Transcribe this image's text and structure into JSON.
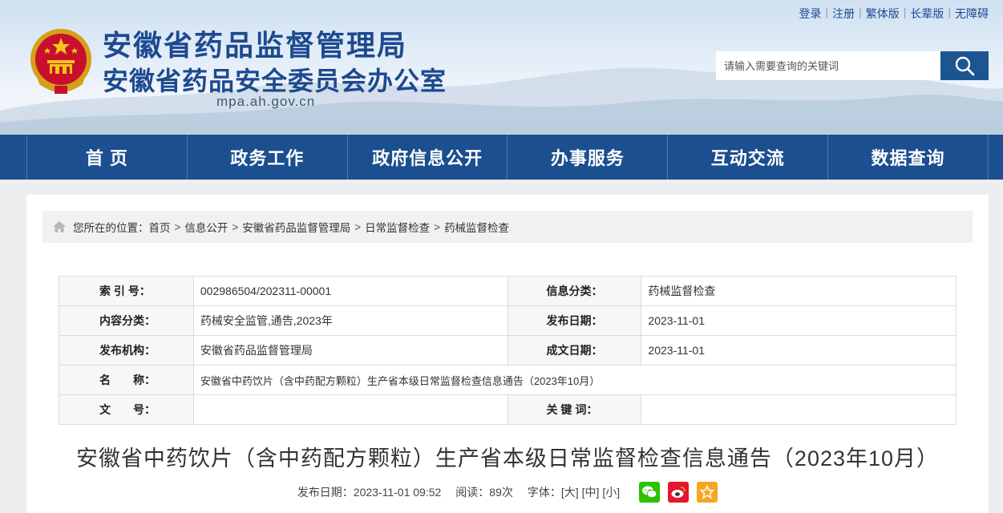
{
  "site": {
    "title_line1": "安徽省药品监督管理局",
    "title_line2": "安徽省药品安全委员会办公室",
    "domain": "mpa.ah.gov.cn"
  },
  "toplinks": [
    "登录",
    "注册",
    "繁体版",
    "长辈版",
    "无障碍"
  ],
  "search": {
    "placeholder": "请输入需要查询的关键词",
    "icon": "search-icon"
  },
  "nav": [
    "首 页",
    "政务工作",
    "政府信息公开",
    "办事服务",
    "互动交流",
    "数据查询"
  ],
  "breadcrumb": {
    "prefix": "您所在的位置：",
    "items": [
      "首页",
      "信息公开",
      "安徽省药品监督管理局",
      "日常监督检查",
      "药械监督检查"
    ],
    "separator": ">"
  },
  "meta_table": {
    "index_label": "索 引 号：",
    "index_value": "002986504/202311-00001",
    "category_label": "信息分类：",
    "category_value": "药械监督检查",
    "content_cat_label": "内容分类：",
    "content_cat_value": "药械安全监管,通告,2023年",
    "publish_date_label": "发布日期：",
    "publish_date_value": "2023-11-01",
    "org_label": "发布机构：",
    "org_value": "安徽省药品监督管理局",
    "created_date_label": "成文日期：",
    "created_date_value": "2023-11-01",
    "name_label": "名　　称：",
    "name_value": "安徽省中药饮片（含中药配方颗粒）生产省本级日常监督检查信息通告（2023年10月）",
    "docno_label": "文　　号：",
    "docno_value": "",
    "keywords_label": "关 键 词：",
    "keywords_value": ""
  },
  "article": {
    "title": "安徽省中药饮片（含中药配方颗粒）生产省本级日常监督检查信息通告（2023年10月）",
    "date_text": "发布日期：2023-11-01 09:52",
    "views_text": "阅读：89次",
    "font_label": "字体：",
    "font_sizes": [
      "[大]",
      "[中]",
      "[小]"
    ]
  },
  "colors": {
    "nav_bg": "#1b4f8f",
    "brand": "#1d4a8f",
    "wechat": "#2dc100",
    "weibo": "#e6162d",
    "favorite": "#f5a623"
  }
}
